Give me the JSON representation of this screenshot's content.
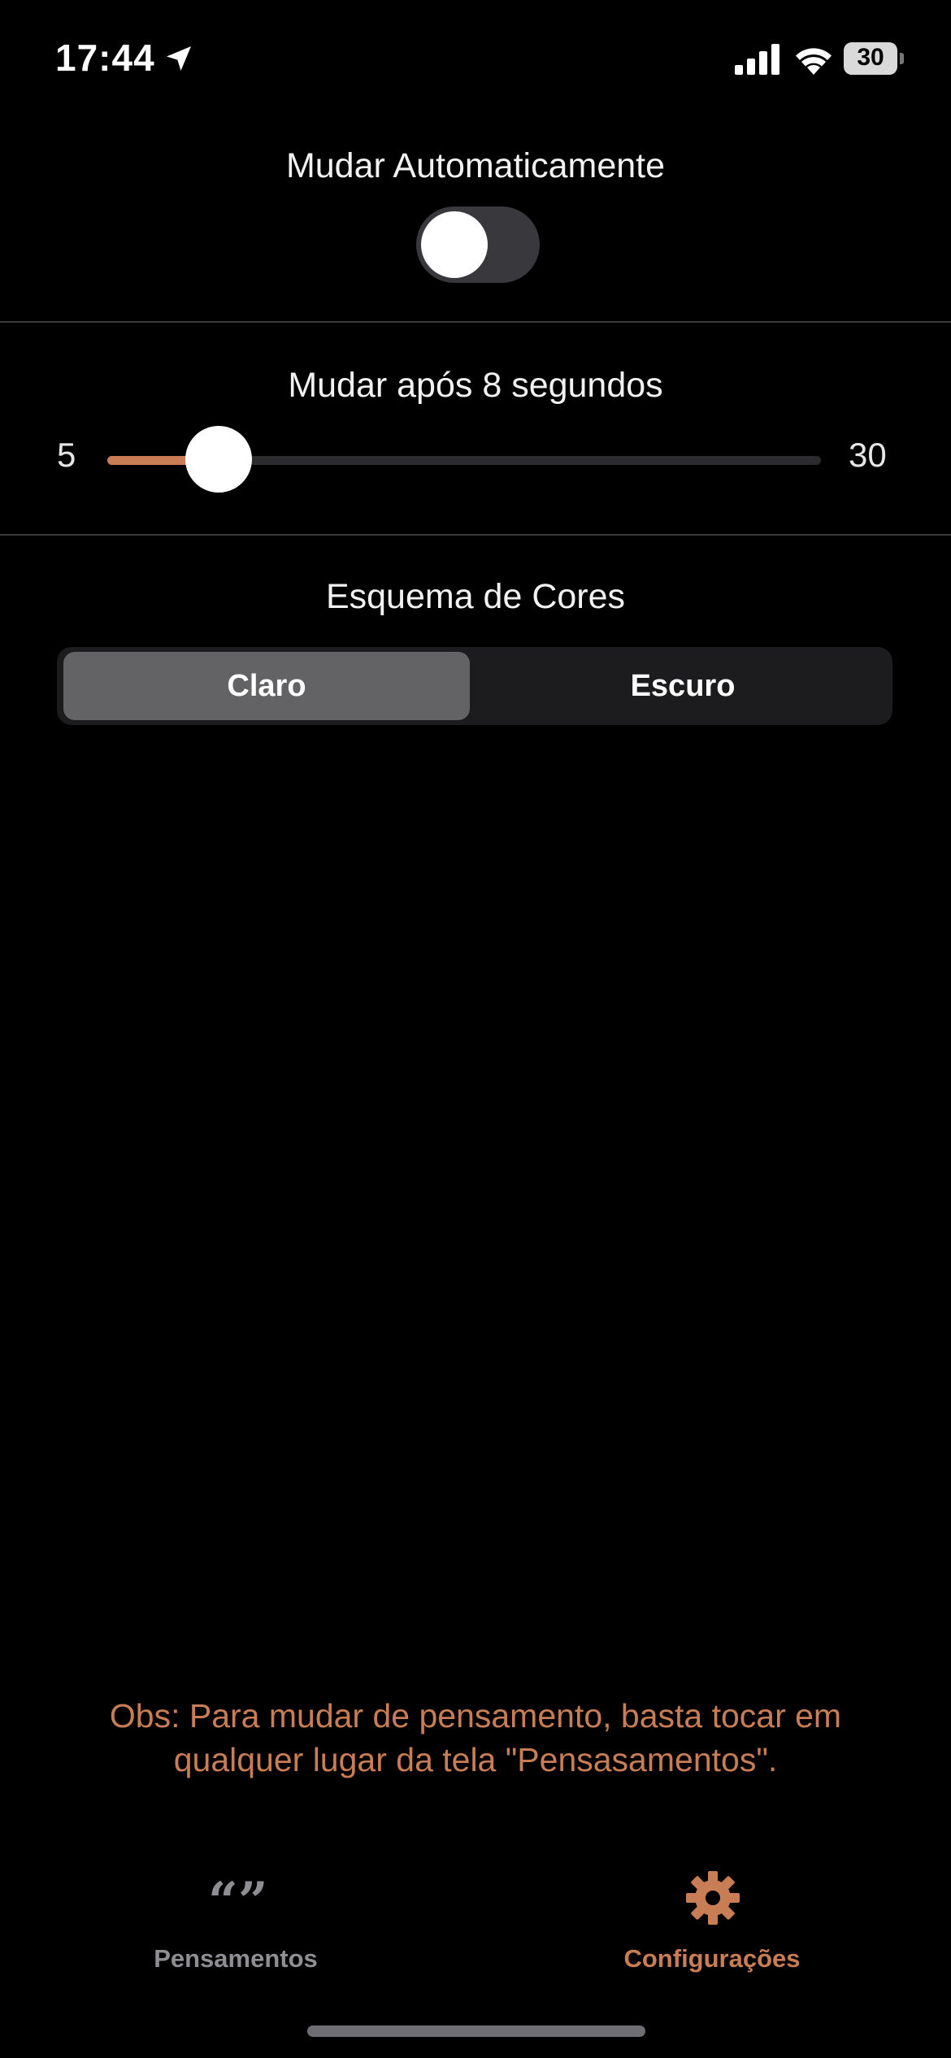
{
  "status_bar": {
    "time": "17:44",
    "battery": "30",
    "icons": [
      "location-arrow-icon",
      "signal-icon",
      "wifi-icon",
      "battery-icon"
    ]
  },
  "auto_change": {
    "title": "Mudar Automaticamente",
    "enabled": false
  },
  "interval": {
    "title": "Mudar após 8 segundos",
    "min_label": "5",
    "max_label": "30",
    "min": 5,
    "max": 30,
    "value": 8
  },
  "color_scheme": {
    "title": "Esquema de Cores",
    "options": [
      "Claro",
      "Escuro"
    ],
    "selected": "Claro"
  },
  "note": "Obs: Para mudar de pensamento, basta tocar em qualquer lugar da tela \"Pensasamentos\".",
  "tab_bar": {
    "tabs": [
      {
        "label": "Pensamentos",
        "icon": "quote-icon",
        "active": false
      },
      {
        "label": "Configurações",
        "icon": "gear-icon",
        "active": true
      }
    ]
  },
  "colors": {
    "accent": "#c97d54",
    "inactive_tab": "#8e8e93",
    "background": "#000000",
    "toggle_off": "#39393d",
    "segment_selected": "#636366"
  }
}
